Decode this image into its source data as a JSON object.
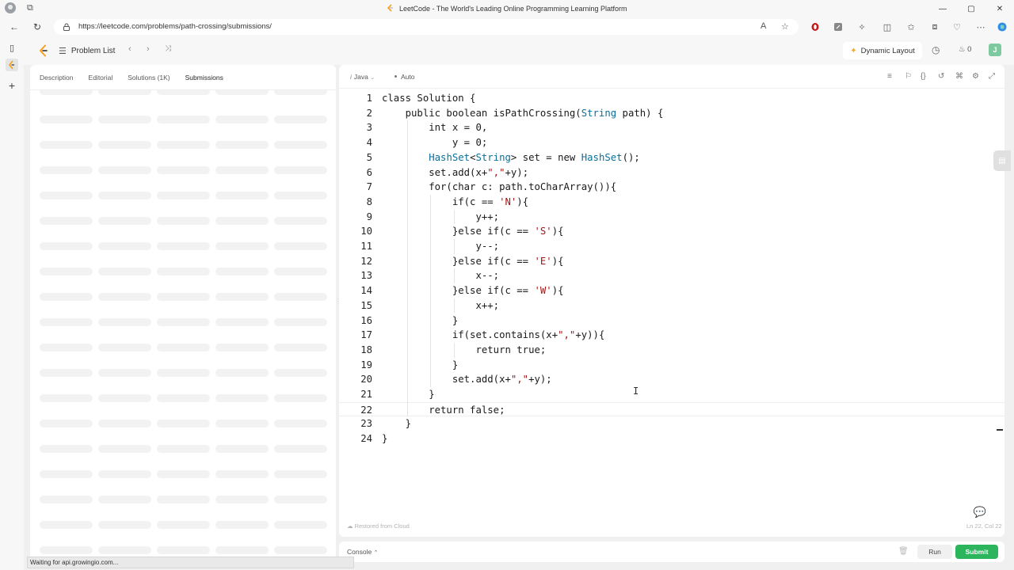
{
  "browser": {
    "window_title": "LeetCode - The World's Leading Online Programming Learning Platform",
    "url": "https://leetcode.com/problems/path-crossing/submissions/"
  },
  "header": {
    "problem_list_label": "Problem List",
    "dynamic_layout_label": "Dynamic Layout",
    "streak_count": "0"
  },
  "left_panel": {
    "tabs": [
      {
        "label": "Description",
        "active": false
      },
      {
        "label": "Editorial",
        "active": false
      },
      {
        "label": "Solutions (1K)",
        "active": false
      },
      {
        "label": "Submissions",
        "active": true
      }
    ]
  },
  "editor": {
    "language": "Java",
    "mode": "Auto",
    "restored_text": "Restored from Cloud",
    "cursor_position": "Ln 22, Col 22",
    "current_line": 22,
    "lines": [
      "class Solution {",
      "    public boolean isPathCrossing(String path) {",
      "        int x = 0,",
      "            y = 0;",
      "        HashSet<String> set = new HashSet();",
      "        set.add(x+\",\"+y);",
      "        for(char c: path.toCharArray()){",
      "            if(c == 'N'){",
      "                y++;",
      "            }else if(c == 'S'){",
      "                y--;",
      "            }else if(c == 'E'){",
      "                x--;",
      "            }else if(c == 'W'){",
      "                x++;",
      "            }",
      "            if(set.contains(x+\",\"+y)){",
      "                return true;",
      "            }",
      "            set.add(x+\",\"+y);",
      "        }",
      "        return false;",
      "    }",
      "}"
    ]
  },
  "console_bar": {
    "console_label": "Console",
    "run_label": "Run",
    "submit_label": "Submit"
  },
  "status_text": "Waiting for api.growingio.com...",
  "colors": {
    "submit_green": "#2db55d",
    "dynamic_layout_star": "#f5a623",
    "brave_red": "#c4161c"
  }
}
